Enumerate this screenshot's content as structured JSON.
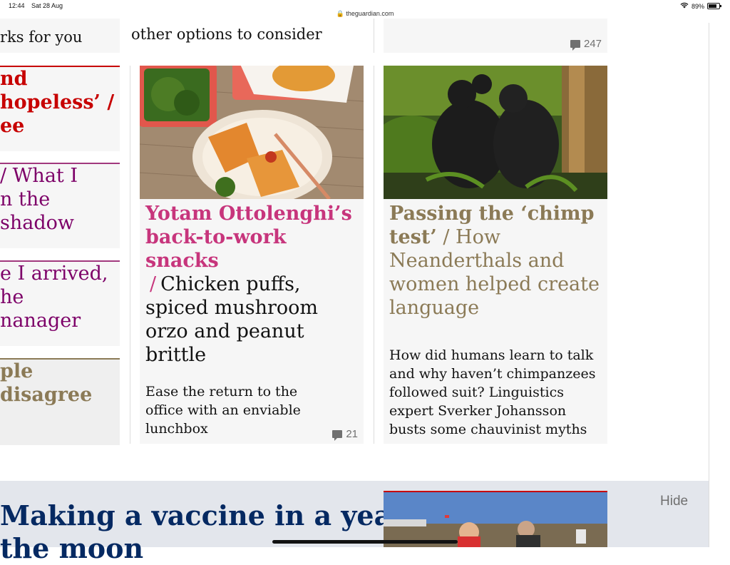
{
  "status_bar": {
    "time": "12:44",
    "date": "Sat 28 Aug",
    "url": "theguardian.com",
    "battery": "89%"
  },
  "top_row": {
    "left_partial": "rks for you",
    "middle_partial": "other options to consider",
    "right_comments": "247"
  },
  "left_column": {
    "item1": "nd hopeless’ /",
    "item1_b": "ee",
    "item2": "/ What I",
    "item2_b": "n the shadow",
    "item3": "e I arrived, he",
    "item3_b": "nanager",
    "item4": "ple disagree"
  },
  "card_ottolenghi": {
    "kicker": "Yotam Ottolenghi’s back-to-work snacks",
    "slash": "/",
    "headline": "Chicken puffs, spiced mushroom orzo and peanut brittle",
    "standfirst": "Ease the return to the office with an enviable lunchbox",
    "comments": "21"
  },
  "card_chimp": {
    "kicker": "Passing the ‘chimp test’",
    "slash": "/",
    "headline": "How Neanderthals and women helped create language",
    "standfirst": "How did humans learn to talk and why haven’t chimpanzees followed suit? Linguistics expert Sverker Johansson busts some chauvinist myths"
  },
  "bottom": {
    "headline": "Making a vaccine in a year",
    "headline_b": "the moon",
    "hide": "Hide"
  },
  "colors": {
    "pink": "#c7357c",
    "gold": "#8b7a56",
    "purple": "#7d0068",
    "red": "#c70000",
    "navy": "#052962"
  }
}
